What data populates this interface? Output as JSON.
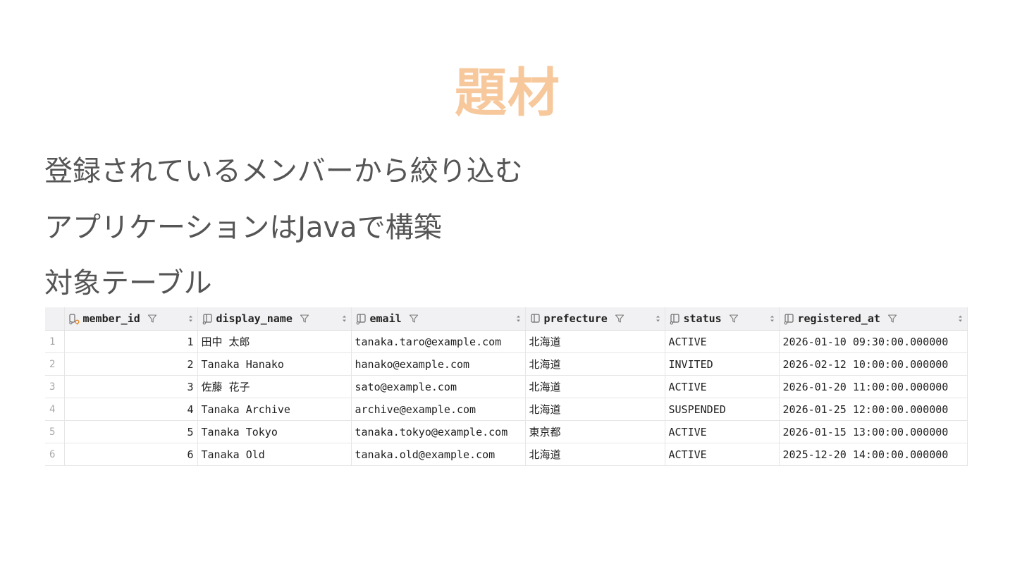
{
  "slide": {
    "title": "題材",
    "bullets": [
      "登録されているメンバーから絞り込む",
      "アプリケーションはJavaで構築",
      "対象テーブル"
    ]
  },
  "colors": {
    "title": "#f6c89c",
    "body_text": "#555555",
    "header_bg": "#f1f1f3",
    "key_icon_accent": "#e08a2c"
  },
  "table": {
    "columns": [
      {
        "name": "member_id",
        "icon": "primary-key-column-icon"
      },
      {
        "name": "display_name",
        "icon": "column-icon"
      },
      {
        "name": "email",
        "icon": "column-icon"
      },
      {
        "name": "prefecture",
        "icon": "column-icon"
      },
      {
        "name": "status",
        "icon": "column-icon"
      },
      {
        "name": "registered_at",
        "icon": "column-icon"
      }
    ],
    "rows": [
      {
        "row": "1",
        "member_id": "1",
        "display_name": "田中 太郎",
        "email": "tanaka.taro@example.com",
        "prefecture": "北海道",
        "status": "ACTIVE",
        "registered_at": "2026-01-10 09:30:00.000000"
      },
      {
        "row": "2",
        "member_id": "2",
        "display_name": "Tanaka Hanako",
        "email": "hanako@example.com",
        "prefecture": "北海道",
        "status": "INVITED",
        "registered_at": "2026-02-12 10:00:00.000000"
      },
      {
        "row": "3",
        "member_id": "3",
        "display_name": "佐藤 花子",
        "email": "sato@example.com",
        "prefecture": "北海道",
        "status": "ACTIVE",
        "registered_at": "2026-01-20 11:00:00.000000"
      },
      {
        "row": "4",
        "member_id": "4",
        "display_name": "Tanaka Archive",
        "email": "archive@example.com",
        "prefecture": "北海道",
        "status": "SUSPENDED",
        "registered_at": "2026-01-25 12:00:00.000000"
      },
      {
        "row": "5",
        "member_id": "5",
        "display_name": "Tanaka Tokyo",
        "email": "tanaka.tokyo@example.com",
        "prefecture": "東京都",
        "status": "ACTIVE",
        "registered_at": "2026-01-15 13:00:00.000000"
      },
      {
        "row": "6",
        "member_id": "6",
        "display_name": "Tanaka Old",
        "email": "tanaka.old@example.com",
        "prefecture": "北海道",
        "status": "ACTIVE",
        "registered_at": "2025-12-20 14:00:00.000000"
      }
    ]
  }
}
